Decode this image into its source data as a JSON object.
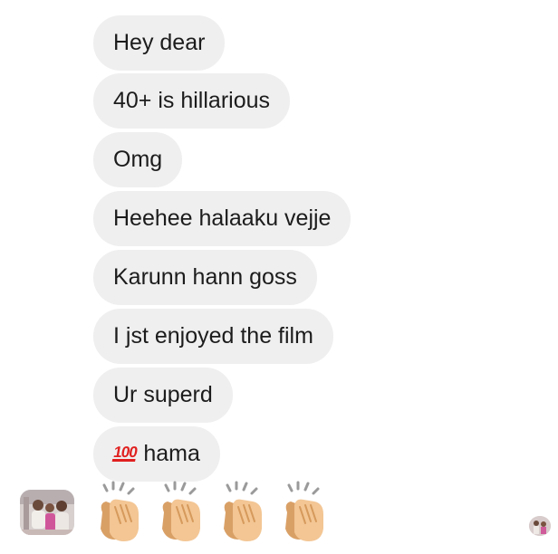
{
  "messages": [
    {
      "text": "Hey dear"
    },
    {
      "text": "40+ is hillarious"
    },
    {
      "text": "Omg"
    },
    {
      "text": "Heehee halaaku vejje"
    },
    {
      "text": "Karunn hann goss"
    },
    {
      "text": "I jst enjoyed the film"
    },
    {
      "text": "Ur superd"
    },
    {
      "emoji": "100",
      "text": "hama"
    }
  ],
  "reaction_message": {
    "emoji": "clapping-hands",
    "count_shown": 4
  },
  "colors": {
    "bubble_bg": "#efefef",
    "text": "#1c1c1c",
    "hundred_red": "#e0201f",
    "clap_skin": "#f3c694"
  }
}
